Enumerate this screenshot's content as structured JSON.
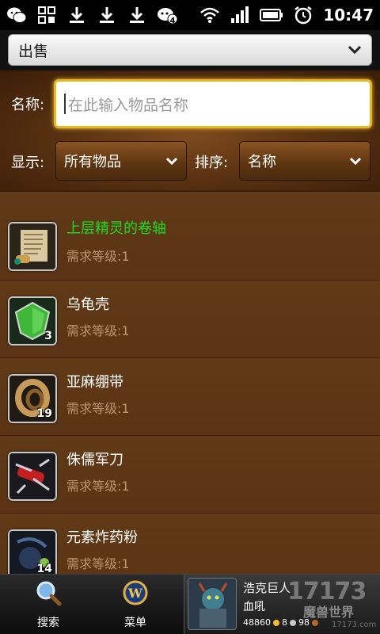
{
  "status_bar": {
    "time": "10:47",
    "notification_count": "4",
    "icons": [
      "wechat-icon",
      "grid-app-icon",
      "download-icon",
      "download-icon",
      "download-icon",
      "notification-icon",
      "wifi-icon",
      "signal-icon",
      "battery-icon",
      "alarm-icon"
    ]
  },
  "top_select": {
    "value": "出售"
  },
  "filters": {
    "name_label": "名称:",
    "name_placeholder": "在此输入物品名称",
    "show_label": "显示:",
    "show_value": "所有物品",
    "sort_label": "排序:",
    "sort_value": "名称"
  },
  "items": [
    {
      "name": "上层精灵的卷轴",
      "level": "需求等级:1",
      "count": "",
      "quality": "uncommon",
      "icon": "scroll-icon"
    },
    {
      "name": "乌龟壳",
      "level": "需求等级:1",
      "count": "3",
      "quality": "common",
      "icon": "turtle-shell-icon"
    },
    {
      "name": "亚麻绷带",
      "level": "需求等级:1",
      "count": "19",
      "quality": "common",
      "icon": "bandage-icon"
    },
    {
      "name": "侏儒军刀",
      "level": "需求等级:1",
      "count": "",
      "quality": "common",
      "icon": "army-knife-icon"
    },
    {
      "name": "元素炸药粉",
      "level": "需求等级:1",
      "count": "14",
      "quality": "common",
      "icon": "powder-pouch-icon"
    }
  ],
  "bottom_nav": {
    "search_label": "搜索",
    "menu_label": "菜单"
  },
  "character": {
    "name": "浩克巨人",
    "realm": "血吼",
    "gold": "48860",
    "silver": "8",
    "copper": "98"
  },
  "watermark": {
    "logo": "17173",
    "sub": "魔兽世界",
    "url": "17173.com"
  },
  "colors": {
    "accent_input": "#e8b820",
    "uncommon_item": "#1edc1e",
    "panel_brown": "#5b3615"
  }
}
